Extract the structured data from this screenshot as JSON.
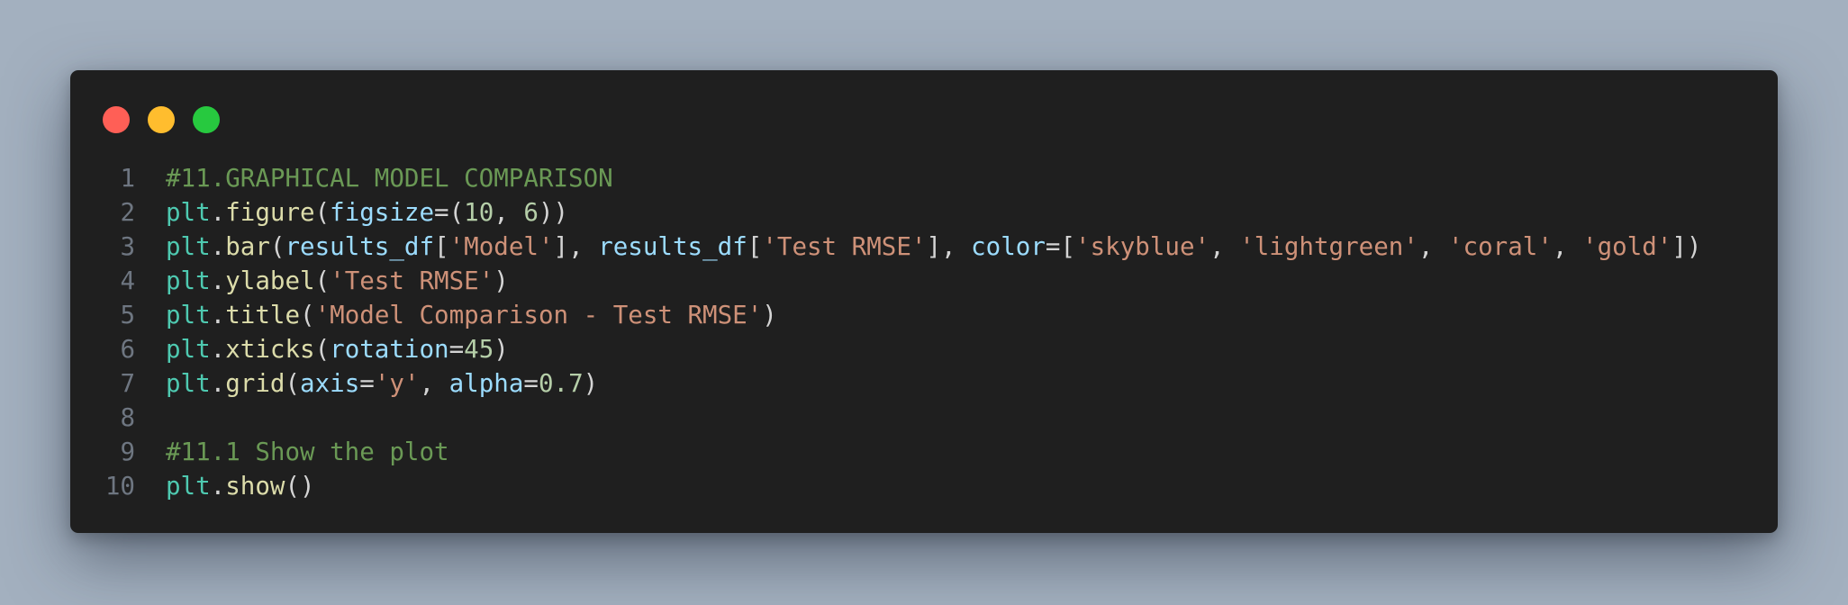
{
  "window": {
    "controls": {
      "close_color": "#ff5f56",
      "minimize_color": "#ffbd2e",
      "maximize_color": "#27c93f"
    }
  },
  "colors": {
    "background": "#a3b0bf",
    "editor_background": "#1f1f1f",
    "comment": "#6a9955",
    "object": "#4ec9b0",
    "function": "#dcdcaa",
    "parameter": "#9cdcfe",
    "number": "#b5cea8",
    "string": "#ce9178",
    "punctuation": "#d4d4d4",
    "line_number": "#6e7681"
  },
  "code": {
    "lines": [
      {
        "number": "1",
        "tokens": [
          {
            "text": "#11.GRAPHICAL MODEL COMPARISON",
            "type": "comment"
          }
        ]
      },
      {
        "number": "2",
        "tokens": [
          {
            "text": "plt",
            "type": "obj"
          },
          {
            "text": ".",
            "type": "punct"
          },
          {
            "text": "figure",
            "type": "func"
          },
          {
            "text": "(",
            "type": "punct"
          },
          {
            "text": "figsize",
            "type": "param"
          },
          {
            "text": "=(",
            "type": "punct"
          },
          {
            "text": "10",
            "type": "num"
          },
          {
            "text": ", ",
            "type": "punct"
          },
          {
            "text": "6",
            "type": "num"
          },
          {
            "text": "))",
            "type": "punct"
          }
        ]
      },
      {
        "number": "3",
        "tokens": [
          {
            "text": "plt",
            "type": "obj"
          },
          {
            "text": ".",
            "type": "punct"
          },
          {
            "text": "bar",
            "type": "func"
          },
          {
            "text": "(",
            "type": "punct"
          },
          {
            "text": "results_df",
            "type": "param"
          },
          {
            "text": "[",
            "type": "punct"
          },
          {
            "text": "'Model'",
            "type": "str"
          },
          {
            "text": "], ",
            "type": "punct"
          },
          {
            "text": "results_df",
            "type": "param"
          },
          {
            "text": "[",
            "type": "punct"
          },
          {
            "text": "'Test RMSE'",
            "type": "str"
          },
          {
            "text": "], ",
            "type": "punct"
          },
          {
            "text": "color",
            "type": "param"
          },
          {
            "text": "=[",
            "type": "punct"
          },
          {
            "text": "'skyblue'",
            "type": "str"
          },
          {
            "text": ", ",
            "type": "punct"
          },
          {
            "text": "'lightgreen'",
            "type": "str"
          },
          {
            "text": ", ",
            "type": "punct"
          },
          {
            "text": "'coral'",
            "type": "str"
          },
          {
            "text": ", ",
            "type": "punct"
          },
          {
            "text": "'gold'",
            "type": "str"
          },
          {
            "text": "])",
            "type": "punct"
          }
        ]
      },
      {
        "number": "4",
        "tokens": [
          {
            "text": "plt",
            "type": "obj"
          },
          {
            "text": ".",
            "type": "punct"
          },
          {
            "text": "ylabel",
            "type": "func"
          },
          {
            "text": "(",
            "type": "punct"
          },
          {
            "text": "'Test RMSE'",
            "type": "str"
          },
          {
            "text": ")",
            "type": "punct"
          }
        ]
      },
      {
        "number": "5",
        "tokens": [
          {
            "text": "plt",
            "type": "obj"
          },
          {
            "text": ".",
            "type": "punct"
          },
          {
            "text": "title",
            "type": "func"
          },
          {
            "text": "(",
            "type": "punct"
          },
          {
            "text": "'Model Comparison - Test RMSE'",
            "type": "str"
          },
          {
            "text": ")",
            "type": "punct"
          }
        ]
      },
      {
        "number": "6",
        "tokens": [
          {
            "text": "plt",
            "type": "obj"
          },
          {
            "text": ".",
            "type": "punct"
          },
          {
            "text": "xticks",
            "type": "func"
          },
          {
            "text": "(",
            "type": "punct"
          },
          {
            "text": "rotation",
            "type": "param"
          },
          {
            "text": "=",
            "type": "punct"
          },
          {
            "text": "45",
            "type": "num"
          },
          {
            "text": ")",
            "type": "punct"
          }
        ]
      },
      {
        "number": "7",
        "tokens": [
          {
            "text": "plt",
            "type": "obj"
          },
          {
            "text": ".",
            "type": "punct"
          },
          {
            "text": "grid",
            "type": "func"
          },
          {
            "text": "(",
            "type": "punct"
          },
          {
            "text": "axis",
            "type": "param"
          },
          {
            "text": "=",
            "type": "punct"
          },
          {
            "text": "'y'",
            "type": "str"
          },
          {
            "text": ", ",
            "type": "punct"
          },
          {
            "text": "alpha",
            "type": "param"
          },
          {
            "text": "=",
            "type": "punct"
          },
          {
            "text": "0.7",
            "type": "num"
          },
          {
            "text": ")",
            "type": "punct"
          }
        ]
      },
      {
        "number": "8",
        "tokens": []
      },
      {
        "number": "9",
        "tokens": [
          {
            "text": "#11.1 Show the plot",
            "type": "comment"
          }
        ]
      },
      {
        "number": "10",
        "tokens": [
          {
            "text": "plt",
            "type": "obj"
          },
          {
            "text": ".",
            "type": "punct"
          },
          {
            "text": "show",
            "type": "func"
          },
          {
            "text": "()",
            "type": "punct"
          }
        ]
      }
    ]
  }
}
